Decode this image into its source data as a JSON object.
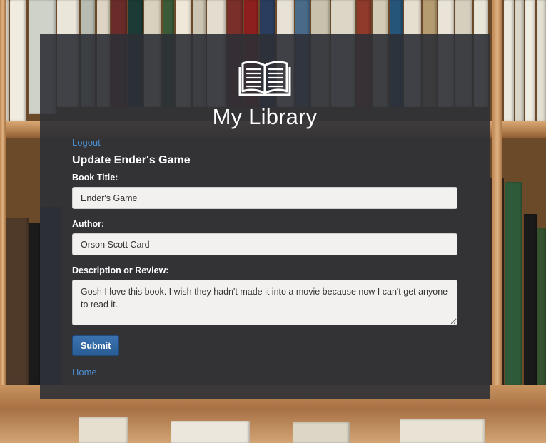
{
  "app": {
    "title": "My Library",
    "logo_icon": "open-book-icon"
  },
  "nav": {
    "logout_label": "Logout",
    "home_label": "Home"
  },
  "form": {
    "heading": "Update Ender's Game",
    "title_label": "Book Title:",
    "title_value": "Ender's Game",
    "author_label": "Author:",
    "author_value": "Orson Scott Card",
    "description_label": "Description or Review:",
    "description_value": "Gosh I love this book. I wish they hadn't made it into a movie because now I can't get anyone to read it.",
    "submit_label": "Submit"
  },
  "colors": {
    "panel_bg": "#2d3036",
    "link": "#4b8fd0",
    "button": "#2a5c95",
    "input_bg": "#f2f1f0"
  }
}
